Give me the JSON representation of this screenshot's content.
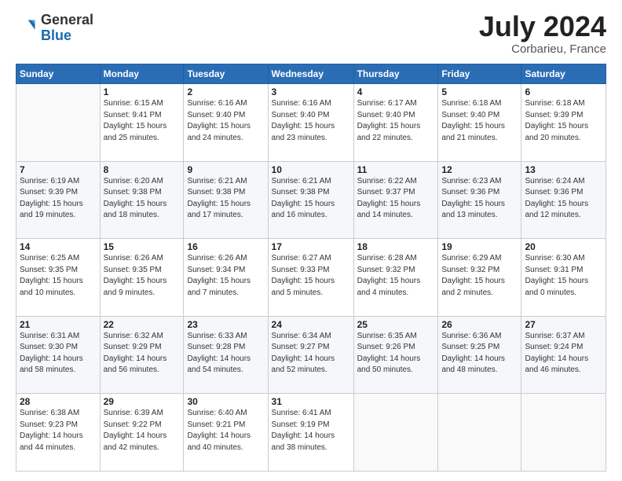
{
  "header": {
    "logo_general": "General",
    "logo_blue": "Blue",
    "title": "July 2024",
    "location": "Corbarieu, France"
  },
  "calendar": {
    "weekdays": [
      "Sunday",
      "Monday",
      "Tuesday",
      "Wednesday",
      "Thursday",
      "Friday",
      "Saturday"
    ],
    "weeks": [
      [
        {
          "day": "",
          "detail": ""
        },
        {
          "day": "1",
          "detail": "Sunrise: 6:15 AM\nSunset: 9:41 PM\nDaylight: 15 hours\nand 25 minutes."
        },
        {
          "day": "2",
          "detail": "Sunrise: 6:16 AM\nSunset: 9:40 PM\nDaylight: 15 hours\nand 24 minutes."
        },
        {
          "day": "3",
          "detail": "Sunrise: 6:16 AM\nSunset: 9:40 PM\nDaylight: 15 hours\nand 23 minutes."
        },
        {
          "day": "4",
          "detail": "Sunrise: 6:17 AM\nSunset: 9:40 PM\nDaylight: 15 hours\nand 22 minutes."
        },
        {
          "day": "5",
          "detail": "Sunrise: 6:18 AM\nSunset: 9:40 PM\nDaylight: 15 hours\nand 21 minutes."
        },
        {
          "day": "6",
          "detail": "Sunrise: 6:18 AM\nSunset: 9:39 PM\nDaylight: 15 hours\nand 20 minutes."
        }
      ],
      [
        {
          "day": "7",
          "detail": "Sunrise: 6:19 AM\nSunset: 9:39 PM\nDaylight: 15 hours\nand 19 minutes."
        },
        {
          "day": "8",
          "detail": "Sunrise: 6:20 AM\nSunset: 9:38 PM\nDaylight: 15 hours\nand 18 minutes."
        },
        {
          "day": "9",
          "detail": "Sunrise: 6:21 AM\nSunset: 9:38 PM\nDaylight: 15 hours\nand 17 minutes."
        },
        {
          "day": "10",
          "detail": "Sunrise: 6:21 AM\nSunset: 9:38 PM\nDaylight: 15 hours\nand 16 minutes."
        },
        {
          "day": "11",
          "detail": "Sunrise: 6:22 AM\nSunset: 9:37 PM\nDaylight: 15 hours\nand 14 minutes."
        },
        {
          "day": "12",
          "detail": "Sunrise: 6:23 AM\nSunset: 9:36 PM\nDaylight: 15 hours\nand 13 minutes."
        },
        {
          "day": "13",
          "detail": "Sunrise: 6:24 AM\nSunset: 9:36 PM\nDaylight: 15 hours\nand 12 minutes."
        }
      ],
      [
        {
          "day": "14",
          "detail": "Sunrise: 6:25 AM\nSunset: 9:35 PM\nDaylight: 15 hours\nand 10 minutes."
        },
        {
          "day": "15",
          "detail": "Sunrise: 6:26 AM\nSunset: 9:35 PM\nDaylight: 15 hours\nand 9 minutes."
        },
        {
          "day": "16",
          "detail": "Sunrise: 6:26 AM\nSunset: 9:34 PM\nDaylight: 15 hours\nand 7 minutes."
        },
        {
          "day": "17",
          "detail": "Sunrise: 6:27 AM\nSunset: 9:33 PM\nDaylight: 15 hours\nand 5 minutes."
        },
        {
          "day": "18",
          "detail": "Sunrise: 6:28 AM\nSunset: 9:32 PM\nDaylight: 15 hours\nand 4 minutes."
        },
        {
          "day": "19",
          "detail": "Sunrise: 6:29 AM\nSunset: 9:32 PM\nDaylight: 15 hours\nand 2 minutes."
        },
        {
          "day": "20",
          "detail": "Sunrise: 6:30 AM\nSunset: 9:31 PM\nDaylight: 15 hours\nand 0 minutes."
        }
      ],
      [
        {
          "day": "21",
          "detail": "Sunrise: 6:31 AM\nSunset: 9:30 PM\nDaylight: 14 hours\nand 58 minutes."
        },
        {
          "day": "22",
          "detail": "Sunrise: 6:32 AM\nSunset: 9:29 PM\nDaylight: 14 hours\nand 56 minutes."
        },
        {
          "day": "23",
          "detail": "Sunrise: 6:33 AM\nSunset: 9:28 PM\nDaylight: 14 hours\nand 54 minutes."
        },
        {
          "day": "24",
          "detail": "Sunrise: 6:34 AM\nSunset: 9:27 PM\nDaylight: 14 hours\nand 52 minutes."
        },
        {
          "day": "25",
          "detail": "Sunrise: 6:35 AM\nSunset: 9:26 PM\nDaylight: 14 hours\nand 50 minutes."
        },
        {
          "day": "26",
          "detail": "Sunrise: 6:36 AM\nSunset: 9:25 PM\nDaylight: 14 hours\nand 48 minutes."
        },
        {
          "day": "27",
          "detail": "Sunrise: 6:37 AM\nSunset: 9:24 PM\nDaylight: 14 hours\nand 46 minutes."
        }
      ],
      [
        {
          "day": "28",
          "detail": "Sunrise: 6:38 AM\nSunset: 9:23 PM\nDaylight: 14 hours\nand 44 minutes."
        },
        {
          "day": "29",
          "detail": "Sunrise: 6:39 AM\nSunset: 9:22 PM\nDaylight: 14 hours\nand 42 minutes."
        },
        {
          "day": "30",
          "detail": "Sunrise: 6:40 AM\nSunset: 9:21 PM\nDaylight: 14 hours\nand 40 minutes."
        },
        {
          "day": "31",
          "detail": "Sunrise: 6:41 AM\nSunset: 9:19 PM\nDaylight: 14 hours\nand 38 minutes."
        },
        {
          "day": "",
          "detail": ""
        },
        {
          "day": "",
          "detail": ""
        },
        {
          "day": "",
          "detail": ""
        }
      ]
    ]
  }
}
